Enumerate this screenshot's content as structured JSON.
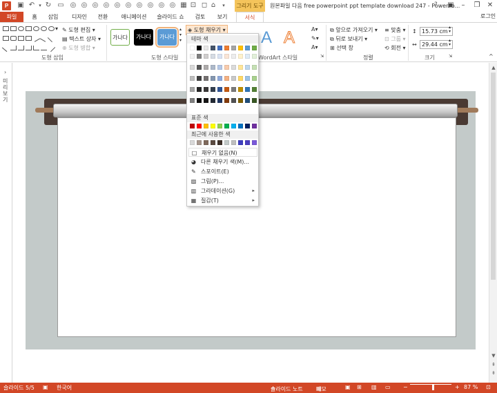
{
  "titlebar": {
    "app_logo": "P",
    "contextual_tab_group": "그리기 도구",
    "window_title": "원본파일 다음 free powerpoint ppt template download 247 - PowerPo..."
  },
  "tabs": [
    {
      "label": "파일"
    },
    {
      "label": "홈"
    },
    {
      "label": "삽입"
    },
    {
      "label": "디자인"
    },
    {
      "label": "전환"
    },
    {
      "label": "애니메이션"
    },
    {
      "label": "슬라이드 쇼"
    },
    {
      "label": "검토"
    },
    {
      "label": "보기"
    },
    {
      "label": "서식"
    }
  ],
  "login_label": "로그인",
  "ribbon": {
    "insert_shapes": {
      "label": "도형 삽입",
      "edit_shape": "도형 편집",
      "text_box": "텍스트 상자",
      "merge_shapes": "도형 병합"
    },
    "shape_styles": {
      "label": "도형 스타일",
      "preset_text": "가나다",
      "shape_fill": "도형 채우기"
    },
    "wordart": {
      "label": "WordArt 스타일",
      "glyph": "A"
    },
    "arrange": {
      "label": "정렬",
      "bring_forward": "앞으로 가져오기",
      "send_backward": "뒤로 보내기",
      "selection_pane": "선택 창",
      "align": "맞춤",
      "group": "그룹",
      "rotate": "회전"
    },
    "size": {
      "label": "크기",
      "height": "15.73 cm",
      "width": "29.44 cm"
    }
  },
  "leftpane": {
    "label": "미리 보기"
  },
  "fill_menu": {
    "theme_colors_label": "테마 색",
    "standard_colors_label": "표준 색",
    "recent_colors_label": "최근에 사용한 색",
    "theme_top_row": [
      "#ffffff",
      "#000000",
      "#e7e6e6",
      "#44546a",
      "#4472c4",
      "#ed7d31",
      "#a5a5a5",
      "#ffc000",
      "#5b9bd5",
      "#70ad47"
    ],
    "theme_shade_rows": [
      [
        "#f2f2f2",
        "#7f7f7f",
        "#d0cece",
        "#d6dce4",
        "#dae3f3",
        "#fbe5d6",
        "#ededed",
        "#fff2cc",
        "#deebf7",
        "#e2f0d9"
      ],
      [
        "#d9d9d9",
        "#595959",
        "#aeabab",
        "#adb9ca",
        "#b4c7e7",
        "#f8cbad",
        "#dbdbdb",
        "#ffe699",
        "#bdd7ee",
        "#c5e0b4"
      ],
      [
        "#bfbfbf",
        "#404040",
        "#757171",
        "#8497b0",
        "#8faadc",
        "#f4b183",
        "#c9c9c9",
        "#ffd966",
        "#9dc3e6",
        "#a9d18e"
      ],
      [
        "#a6a6a6",
        "#262626",
        "#3a3838",
        "#333f50",
        "#2f5597",
        "#c55a11",
        "#7b7b7b",
        "#bf9000",
        "#2e75b6",
        "#538135"
      ],
      [
        "#808080",
        "#0d0d0d",
        "#171616",
        "#222a35",
        "#203864",
        "#843c0c",
        "#525252",
        "#7f6000",
        "#1f4e79",
        "#385723"
      ]
    ],
    "standard_colors": [
      "#c00000",
      "#ff0000",
      "#ffc000",
      "#ffff00",
      "#92d050",
      "#00b050",
      "#00b0f0",
      "#0070c0",
      "#002060",
      "#7030a0"
    ],
    "recent_colors": [
      "#d9d9d9",
      "#a6968c",
      "#7f6a5c",
      "#5b4a40",
      "#3d3028",
      "#c3cac9",
      "#bfbfbf",
      "#3f3fbf",
      "#4b3fbf",
      "#7a59d9"
    ],
    "items": {
      "no_fill": "채우기 없음(N)",
      "more_colors": "다른 채우기 색(M)...",
      "eyedropper": "스포이트(E)",
      "picture": "그림(P)...",
      "gradient": "그라데이션(G)",
      "texture": "질감(T)"
    }
  },
  "statusbar": {
    "slide_info": "슬라이드 5/5",
    "language": "한국어",
    "notes": "슬라이드 노트",
    "comments": "메모",
    "zoom_percent": "87 %",
    "zoom_level": 0.55
  }
}
